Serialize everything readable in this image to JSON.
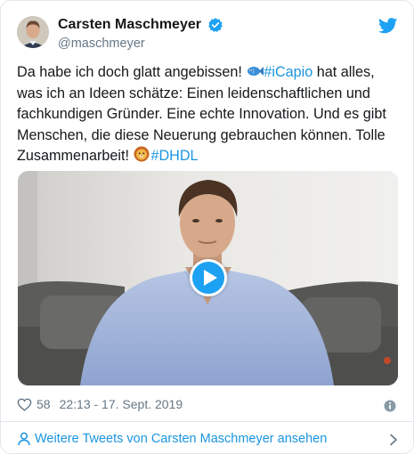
{
  "tweet": {
    "author": {
      "display_name": "Carsten Maschmeyer",
      "handle": "@maschmeyer",
      "verified": true
    },
    "text_segments": [
      {
        "text": "Da habe ich doch glatt angebissen! ",
        "type": "text"
      },
      {
        "emoji": "fish-emoji"
      },
      {
        "text": " #iCapio",
        "type": "link"
      },
      {
        "text": " hat alles, was ich an Ideen schätze: Einen leidenschaftlichen und fachkundigen Gründer. Eine echte Innovation. Und es gibt Menschen, die diese Neuerung gebrauchen können. Tolle Zusammenarbeit! ",
        "type": "text"
      },
      {
        "emoji": "lion-emoji"
      },
      {
        "text": " #DHDL",
        "type": "link"
      }
    ],
    "text_part1": "Da habe ich doch glatt angebissen! ",
    "hashtag1": "#iCapio",
    "text_part2": " hat alles, was ich an Ideen schätze: Einen leidenschaftlichen und fachkundigen Gründer. Eine echte Innovation. Und es gibt Menschen, die diese Neuerung gebrauchen können. Tolle Zusammenarbeit! ",
    "hashtag2": "#DHDL",
    "media": {
      "type": "video",
      "icon": "play-icon"
    },
    "likes": "58",
    "timestamp": "22:13 - 17. Sept. 2019"
  },
  "footer": {
    "more_tweets_label": "Weitere Tweets von Carsten Maschmeyer ansehen"
  },
  "colors": {
    "link": "#1b95e0",
    "twitter_blue": "#1da1f2",
    "secondary_text": "#657786",
    "border": "#e1e8ed"
  },
  "icons": [
    "verified-badge-icon",
    "twitter-bird-icon",
    "fish-emoji",
    "lion-emoji",
    "play-icon",
    "heart-icon",
    "info-icon",
    "person-icon",
    "chevron-right-icon"
  ]
}
